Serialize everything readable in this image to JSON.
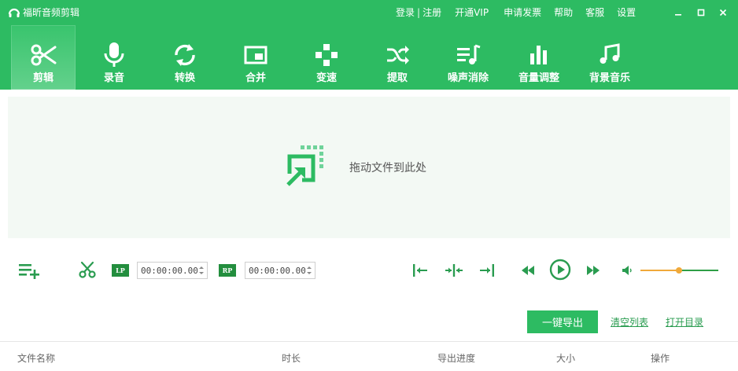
{
  "app": {
    "title": "福昕音频剪辑"
  },
  "header_links": [
    {
      "label": "登录"
    },
    {
      "label": "|"
    },
    {
      "label": "注册"
    },
    {
      "label": "开通VIP"
    },
    {
      "label": "申请发票"
    },
    {
      "label": "帮助"
    },
    {
      "label": "客服"
    },
    {
      "label": "设置"
    }
  ],
  "toolbar": [
    {
      "label": "剪辑",
      "icon": "scissors-icon",
      "active": true
    },
    {
      "label": "录音",
      "icon": "microphone-icon"
    },
    {
      "label": "转换",
      "icon": "convert-icon"
    },
    {
      "label": "合并",
      "icon": "merge-icon"
    },
    {
      "label": "变速",
      "icon": "speed-icon"
    },
    {
      "label": "提取",
      "icon": "shuffle-icon"
    },
    {
      "label": "噪声消除",
      "icon": "noise-removal-icon"
    },
    {
      "label": "音量调整",
      "icon": "volume-bars-icon"
    },
    {
      "label": "背景音乐",
      "icon": "music-note-icon"
    }
  ],
  "dropzone": {
    "text": "拖动文件到此处"
  },
  "controls": {
    "lp_tag": "LP",
    "rp_tag": "RP",
    "lp_time": "00:00:00.00",
    "rp_time": "00:00:00.00",
    "volume": 0.49
  },
  "actions": {
    "export": "一键导出",
    "clear": "清空列表",
    "open_dir": "打开目录"
  },
  "table": {
    "columns": [
      "文件名称",
      "时长",
      "导出进度",
      "大小",
      "操作"
    ]
  },
  "colors": {
    "brand": "#2dbb62",
    "brand_dark": "#238e3e",
    "accent": "#f0a93a"
  }
}
